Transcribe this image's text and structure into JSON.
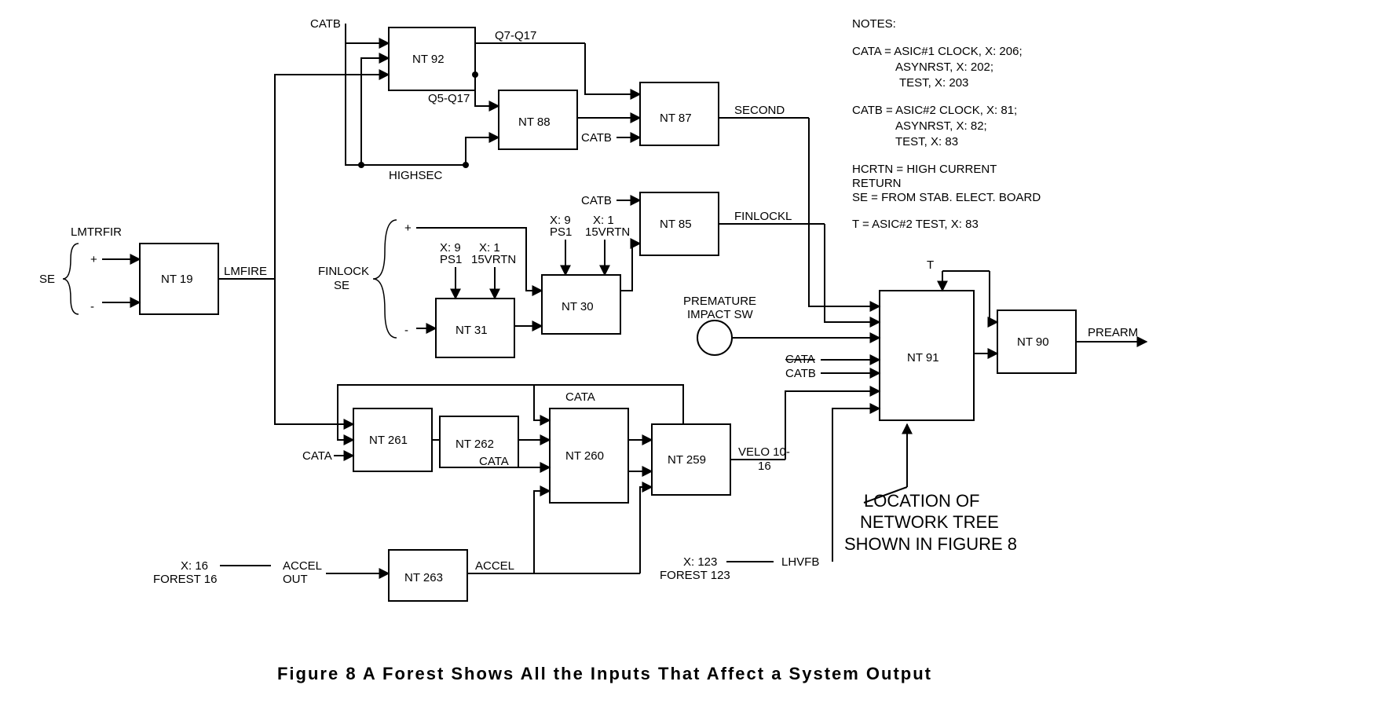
{
  "caption": "Figure 8   A Forest Shows All the Inputs That Affect a System Output",
  "blocks": {
    "nt19": "NT 19",
    "nt92": "NT 92",
    "nt88": "NT 88",
    "nt87": "NT 87",
    "nt85": "NT 85",
    "nt31": "NT 31",
    "nt30": "NT 30",
    "nt261": "NT 261",
    "nt262": "NT 262",
    "nt260": "NT 260",
    "nt259": "NT 259",
    "nt263": "NT 263",
    "nt91": "NT 91",
    "nt90": "NT 90"
  },
  "labels": {
    "se": "SE",
    "lmtrfir": "LMTRFIR",
    "plus": "+",
    "minus": "-",
    "lmfire": "LMFIRE",
    "catb": "CATB",
    "cata": "CATA",
    "q7q17": "Q7-Q17",
    "q5q17": "Q5-Q17",
    "highsec": "HIGHSEC",
    "finlock_se": "FINLOCK",
    "finlock_se2": "SE",
    "x9ps1": "X:  9",
    "ps1": "PS1",
    "x1_15vrtn": "X:  1",
    "v15vrtn": "15VRTN",
    "second": "SECOND",
    "finlockl": "FINLOCKL",
    "premature": "PREMATURE",
    "impact_sw": "IMPACT SW",
    "velo": "VELO 10-",
    "velo2": "16",
    "accel_out": "ACCEL",
    "accel_out2": "OUT",
    "accel": "ACCEL",
    "x16": "X:  16",
    "forest16": "FOREST 16",
    "x123": "X:  123",
    "forest123": "FOREST 123",
    "lhvfb": "LHVFB",
    "t": "T",
    "prearm": "PREARM",
    "location1": "LOCATION OF",
    "location2": "NETWORK TREE",
    "location3": "SHOWN IN FIGURE 8"
  },
  "notes": {
    "title": "NOTES:",
    "l1": "CATA = ASIC#1 CLOCK, X:  206;",
    "l2": "ASYNRST, X:  202;",
    "l3": "TEST, X:  203",
    "l4": "CATB = ASIC#2 CLOCK, X:  81;",
    "l5": "ASYNRST, X:  82;",
    "l6": "TEST, X:  83",
    "l7": "HCRTN = HIGH CURRENT",
    "l8": "RETURN",
    "l9": "SE = FROM STAB. ELECT. BOARD",
    "l10": "T = ASIC#2 TEST, X:  83"
  }
}
